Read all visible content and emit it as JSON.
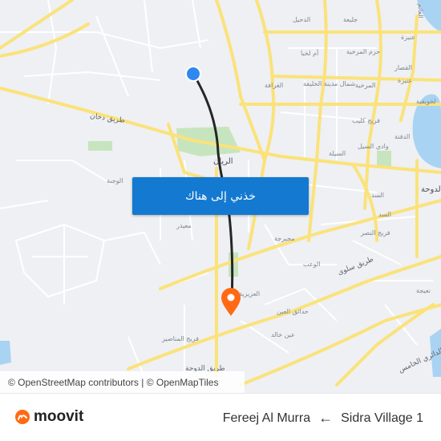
{
  "map": {
    "labels": [
      {
        "text": "الدحيل",
        "k": "n"
      },
      {
        "text": "جليعة",
        "k": "n"
      },
      {
        "text": "أم لخبا",
        "k": "n"
      },
      {
        "text": "حزم المرخية",
        "k": "n"
      },
      {
        "text": "عنيزة",
        "k": "n"
      },
      {
        "text": "القصار",
        "k": "n"
      },
      {
        "text": "الغرافة",
        "k": "n"
      },
      {
        "text": "شمال مدينة الخليفة",
        "k": "n"
      },
      {
        "text": "المرخية",
        "k": "n"
      },
      {
        "text": "عنيزة",
        "k": "n"
      },
      {
        "text": "لخويفية",
        "k": "n"
      },
      {
        "text": "فريج كليب",
        "k": "n"
      },
      {
        "text": "وادي السيل",
        "k": "n"
      },
      {
        "text": "الدفنة",
        "k": "n"
      },
      {
        "text": "طريق دخان",
        "k": "rd"
      },
      {
        "text": "الريان",
        "k": "big"
      },
      {
        "text": "الوجبة",
        "k": "n"
      },
      {
        "text": "السيلة",
        "k": "n"
      },
      {
        "text": "السد",
        "k": "n"
      },
      {
        "text": "السد",
        "k": "n"
      },
      {
        "text": "الدوحة",
        "k": "big"
      },
      {
        "text": "معيذر",
        "k": "n"
      },
      {
        "text": "مجيرجة",
        "k": "n"
      },
      {
        "text": "فريج النصر",
        "k": "n"
      },
      {
        "text": "الوعب",
        "k": "n"
      },
      {
        "text": "طريق سلوى",
        "k": "rd"
      },
      {
        "text": "نعيجة",
        "k": "n"
      },
      {
        "text": "العزيزية",
        "k": "n"
      },
      {
        "text": "حدائق العين",
        "k": "n"
      },
      {
        "text": "عين خالد",
        "k": "n"
      },
      {
        "text": "فريج المناصير",
        "k": "n"
      },
      {
        "text": "الدائري الخامس",
        "k": "rd"
      },
      {
        "text": "طريق الدوحة",
        "k": "rd"
      },
      {
        "text": "الغانم",
        "k": "n"
      }
    ],
    "cta_label": "خذني إلى هناك",
    "attribution": "© OpenStreetMap contributors | © OpenMapTiles",
    "colors": {
      "route": "#262626",
      "origin": "#2f88f0",
      "destination": "#ff6a13",
      "road": "#fbe27a",
      "water": "#a9d3f2",
      "park": "#c6e5be"
    }
  },
  "footer": {
    "brand": "moovit",
    "from": "Sidra Village 1",
    "to": "Fereej Al Murra",
    "arrow": "←"
  }
}
